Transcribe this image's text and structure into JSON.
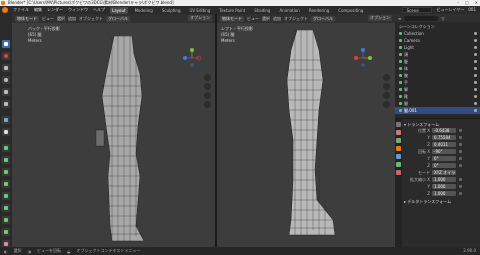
{
  "window": {
    "title": "Blender* [C:\\Users\\MV\\Pictures\\ボクビワの3DCG\\素材\\Blender\\キャラ\\ボクビワ.blend]",
    "controls": [
      "–",
      "□",
      "✕"
    ]
  },
  "menubar": {
    "menus": [
      "ファイル",
      "編集",
      "レンダー",
      "ウィンドウ",
      "ヘルプ"
    ],
    "workspaces": [
      "Layout",
      "Modeling",
      "Sculpting",
      "UV Editing",
      "Texture Paint",
      "Shading",
      "Animation",
      "Rendering",
      "Compositing"
    ],
    "active_workspace": "Layout",
    "scene": "Scene",
    "view_layer": "ビューレイヤー",
    "view_layer_value": "001"
  },
  "viewport_left": {
    "mode": "物体モード",
    "menus": [
      "ビュー",
      "選択",
      "追加",
      "オブジェクト"
    ],
    "view_name": "バック・平行投影",
    "collection": "(65) 腿",
    "unit": "Meters",
    "transform": "グローバル",
    "options": "オプション"
  },
  "viewport_right": {
    "mode": "物体モード",
    "menus": [
      "ビュー",
      "選択",
      "追加",
      "オブジェクト"
    ],
    "view_name": "レフト・平行投影",
    "collection": "(65) 腿",
    "unit": "Meters",
    "transform": "グローバル",
    "options": "オプション"
  },
  "outliner": {
    "root": "シーンコレクション",
    "rows": [
      "Collection",
      "Camera",
      "Light",
      "頭",
      "髪",
      "体",
      "腕",
      "手",
      "脚",
      "靴",
      "腿",
      "腿.001"
    ],
    "selected_index": 11
  },
  "properties": {
    "section_transform": "トランスフォーム",
    "location_label": "位置 X",
    "location": [
      "-0.6438",
      "0.75584",
      "0.4011"
    ],
    "rotation_label": "回転 X",
    "rotation": [
      "-90°",
      "0°",
      "0°"
    ],
    "mode_label": "モード",
    "mode_value": "XYZ オイラー",
    "scale_label": "拡大縮小 X",
    "scale": [
      "1.000",
      "1.000",
      "1.000"
    ],
    "axis_labels": [
      "Y",
      "Z"
    ],
    "section_delta": "デルタトランスフォーム"
  },
  "statusbar": {
    "items": [
      "選択",
      "ビューを回転",
      "オブジェクトコンテキストメニュー"
    ],
    "version": "2.90.0"
  },
  "colors": {
    "accent": "#3d6ea8",
    "selection": "#334d80",
    "brand": "#e87d0d",
    "axis_x": "#e0394e",
    "axis_y": "#7fc241",
    "axis_z": "#3c7ddb"
  }
}
